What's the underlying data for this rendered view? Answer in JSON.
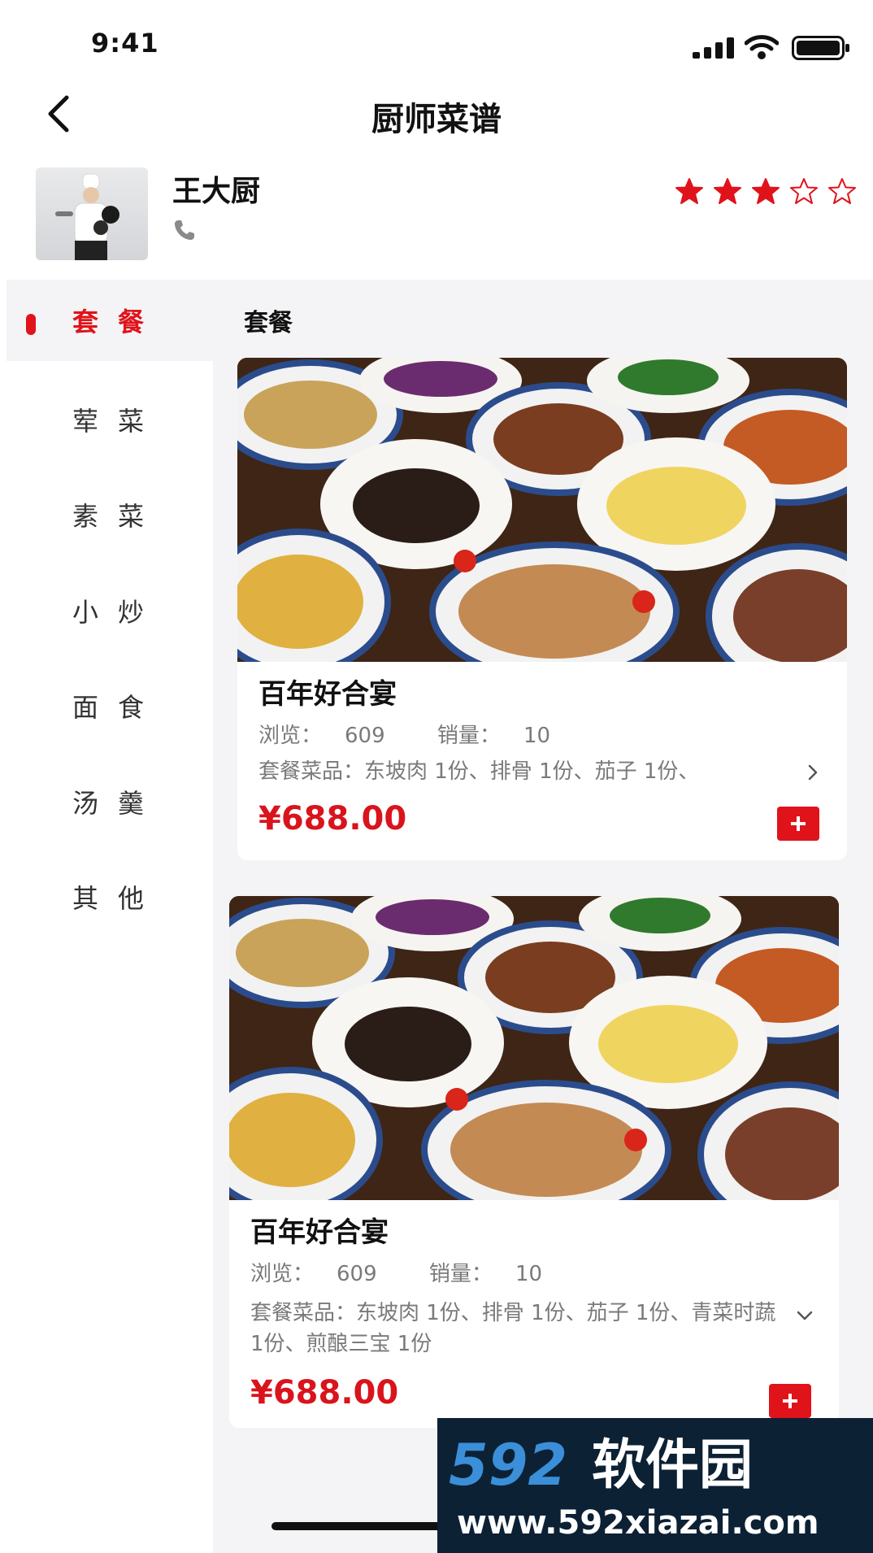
{
  "status_bar": {
    "time": "9:41"
  },
  "nav": {
    "title": "厨师菜谱"
  },
  "chef": {
    "name": "王大厨",
    "rating": 3,
    "rating_max": 5
  },
  "sidebar": {
    "items": [
      {
        "label": "套餐",
        "active": true
      },
      {
        "label": "荤菜",
        "active": false
      },
      {
        "label": "素菜",
        "active": false
      },
      {
        "label": "小炒",
        "active": false
      },
      {
        "label": "面食",
        "active": false
      },
      {
        "label": "汤羹",
        "active": false
      },
      {
        "label": "其他",
        "active": false
      }
    ]
  },
  "section": {
    "title": "套餐"
  },
  "cards": [
    {
      "name": "百年好合宴",
      "views_label": "浏览：",
      "views": "609",
      "sales_label": "销量：",
      "sales": "10",
      "dishes": "套餐菜品：东坡肉 1份、排骨 1份、茄子 1份、",
      "price": "¥688.00",
      "expanded": false
    },
    {
      "name": "百年好合宴",
      "views_label": "浏览：",
      "views": "609",
      "sales_label": "销量：",
      "sales": "10",
      "dishes": "套餐菜品：东坡肉 1份、排骨 1份、茄子 1份、青菜时蔬 1份、煎酿三宝 1份",
      "price": "¥688.00",
      "expanded": true
    }
  ],
  "watermark": {
    "brand_text": "592软件园",
    "url": "www.592xiazai.com"
  },
  "colors": {
    "accent": "#e0131b",
    "price": "#d9141c",
    "muted_text": "#7a7a7a",
    "panel_bg": "#f4f4f6"
  },
  "icons": [
    "back-arrow",
    "phone",
    "star-filled",
    "star-outline",
    "chevron-right",
    "chevron-down",
    "plus"
  ]
}
